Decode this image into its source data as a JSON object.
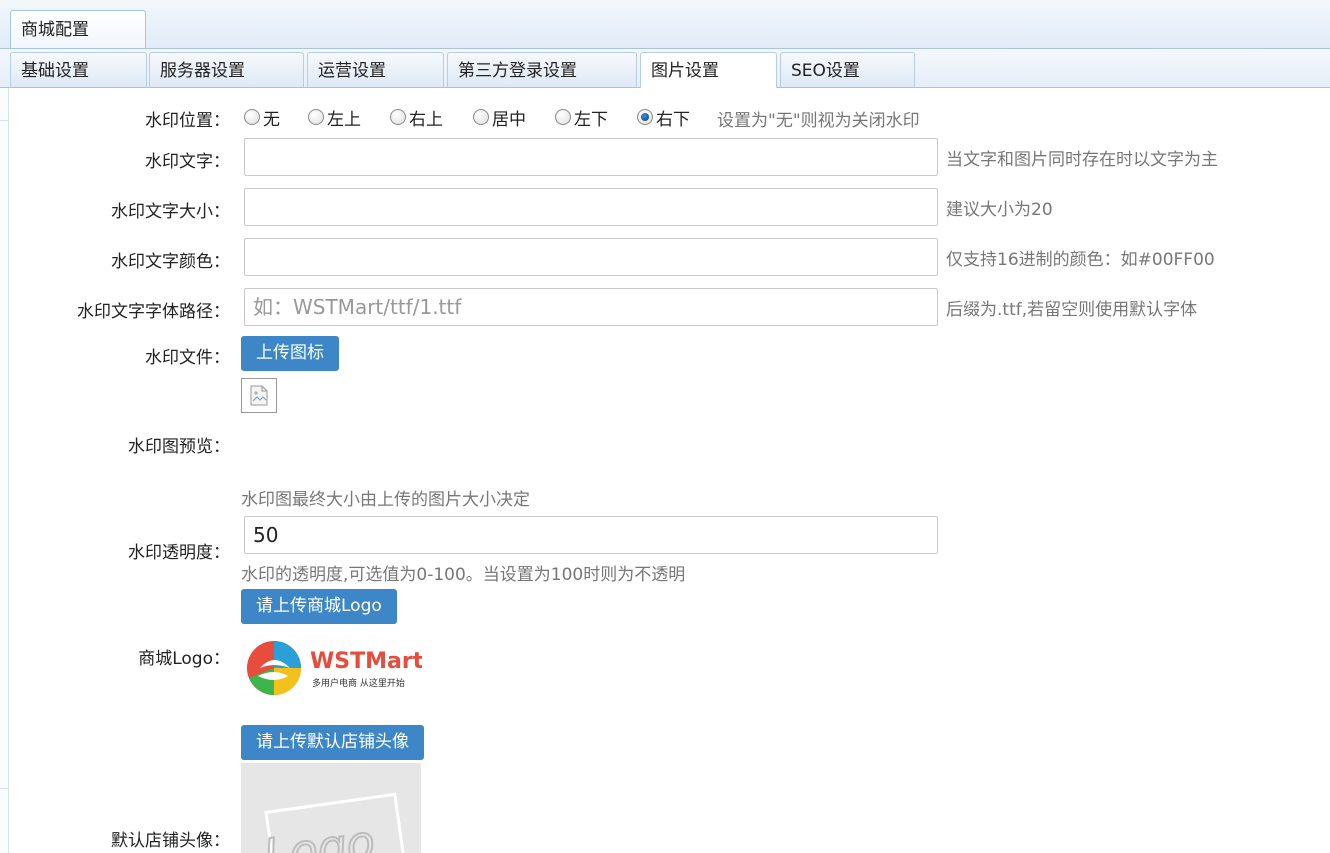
{
  "outer_tab": "商城配置",
  "tabs": [
    {
      "label": "基础设置",
      "active": false
    },
    {
      "label": "服务器设置",
      "active": false
    },
    {
      "label": "运营设置",
      "active": false
    },
    {
      "label": "第三方登录设置",
      "active": false
    },
    {
      "label": "图片设置",
      "active": true
    },
    {
      "label": "SEO设置",
      "active": false
    }
  ],
  "watermark_position": {
    "label": "水印位置：",
    "options": [
      "无",
      "左上",
      "右上",
      "居中",
      "左下",
      "右下"
    ],
    "selected": "右下",
    "hint": "设置为\"无\"则视为关闭水印"
  },
  "watermark_text": {
    "label": "水印文字：",
    "value": "",
    "hint": "当文字和图片同时存在时以文字为主"
  },
  "watermark_text_size": {
    "label": "水印文字大小：",
    "value": "",
    "hint": "建议大小为20"
  },
  "watermark_text_color": {
    "label": "水印文字颜色：",
    "value": "",
    "hint": "仅支持16进制的颜色：如#00FF00"
  },
  "watermark_font_path": {
    "label": "水印文字字体路径：",
    "value": "",
    "placeholder": "如：WSTMart/ttf/1.ttf",
    "hint": "后缀为.ttf,若留空则使用默认字体"
  },
  "watermark_file": {
    "label": "水印文件：",
    "button": "上传图标"
  },
  "watermark_preview": {
    "label": "水印图预览：",
    "hint": "水印图最终大小由上传的图片大小决定"
  },
  "watermark_opacity": {
    "label": "水印透明度：",
    "value": "50",
    "hint": "水印的透明度,可选值为0-100。当设置为100时则为不透明"
  },
  "mall_logo": {
    "label": "商城Logo：",
    "button": "请上传商城Logo",
    "logo_word": "WSTMart",
    "logo_tagline": "多用户电商  从这里开始"
  },
  "default_shop_avatar": {
    "label": "默认店铺头像：",
    "button": "请上传默认店铺头像",
    "placeholder_art": "Logo"
  },
  "colors": {
    "accent": "#3d87c9",
    "tab_border": "#a8c4e0",
    "hint_text": "#777777"
  }
}
